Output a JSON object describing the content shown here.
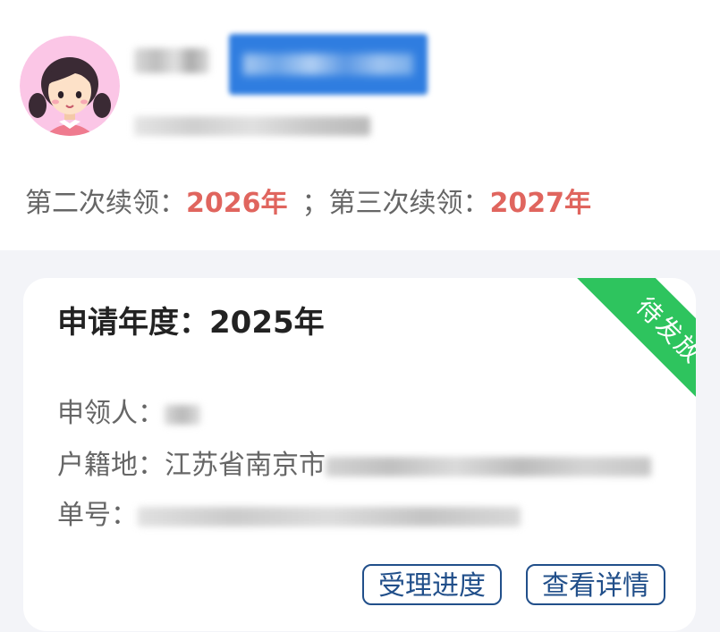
{
  "profile": {
    "avatar_icon": "girl-avatar-icon"
  },
  "renewal": {
    "second_label": "第二次续领：",
    "second_year": "2026年",
    "separator": "；",
    "third_label": "第三次续领：",
    "third_year": "2027年"
  },
  "card": {
    "title": "申请年度：2025年",
    "status": "待发放",
    "status_color": "#2ec45e",
    "applicant_label": "申领人：",
    "residence_label": "户籍地：",
    "residence_value": "江苏省南京市",
    "number_label": "单号：",
    "progress_button": "受理进度",
    "details_button": "查看详情"
  },
  "colors": {
    "accent_red": "#e0655e",
    "button_border": "#214f8a",
    "highlight_blue": "#2f7de0"
  }
}
